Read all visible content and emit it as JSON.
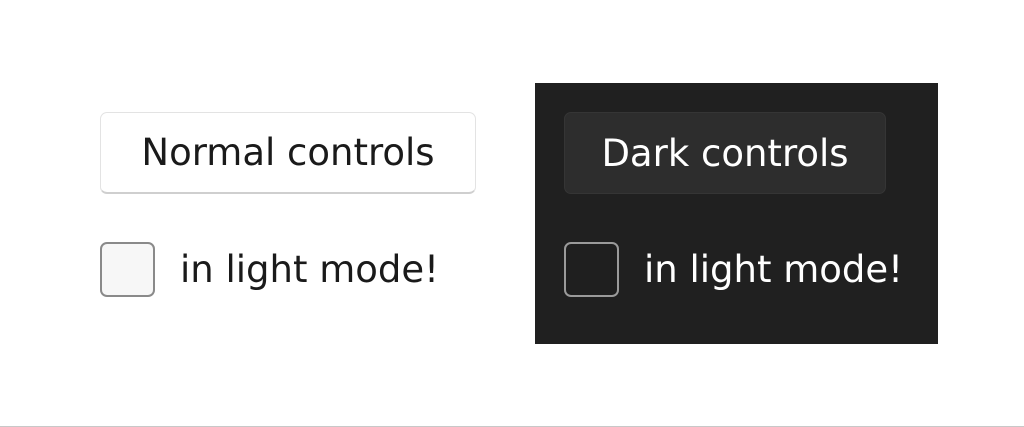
{
  "light_panel": {
    "button_label": "Normal controls",
    "checkbox_label": "in light mode!",
    "checkbox_checked": false
  },
  "dark_panel": {
    "button_label": "Dark controls",
    "checkbox_label": "in light mode!",
    "checkbox_checked": false
  },
  "colors": {
    "page_background": "#ffffff",
    "dark_panel_background": "#202020",
    "dark_button_background": "#2d2d2d",
    "light_text": "#1a1a1a",
    "dark_text": "#ffffff"
  }
}
